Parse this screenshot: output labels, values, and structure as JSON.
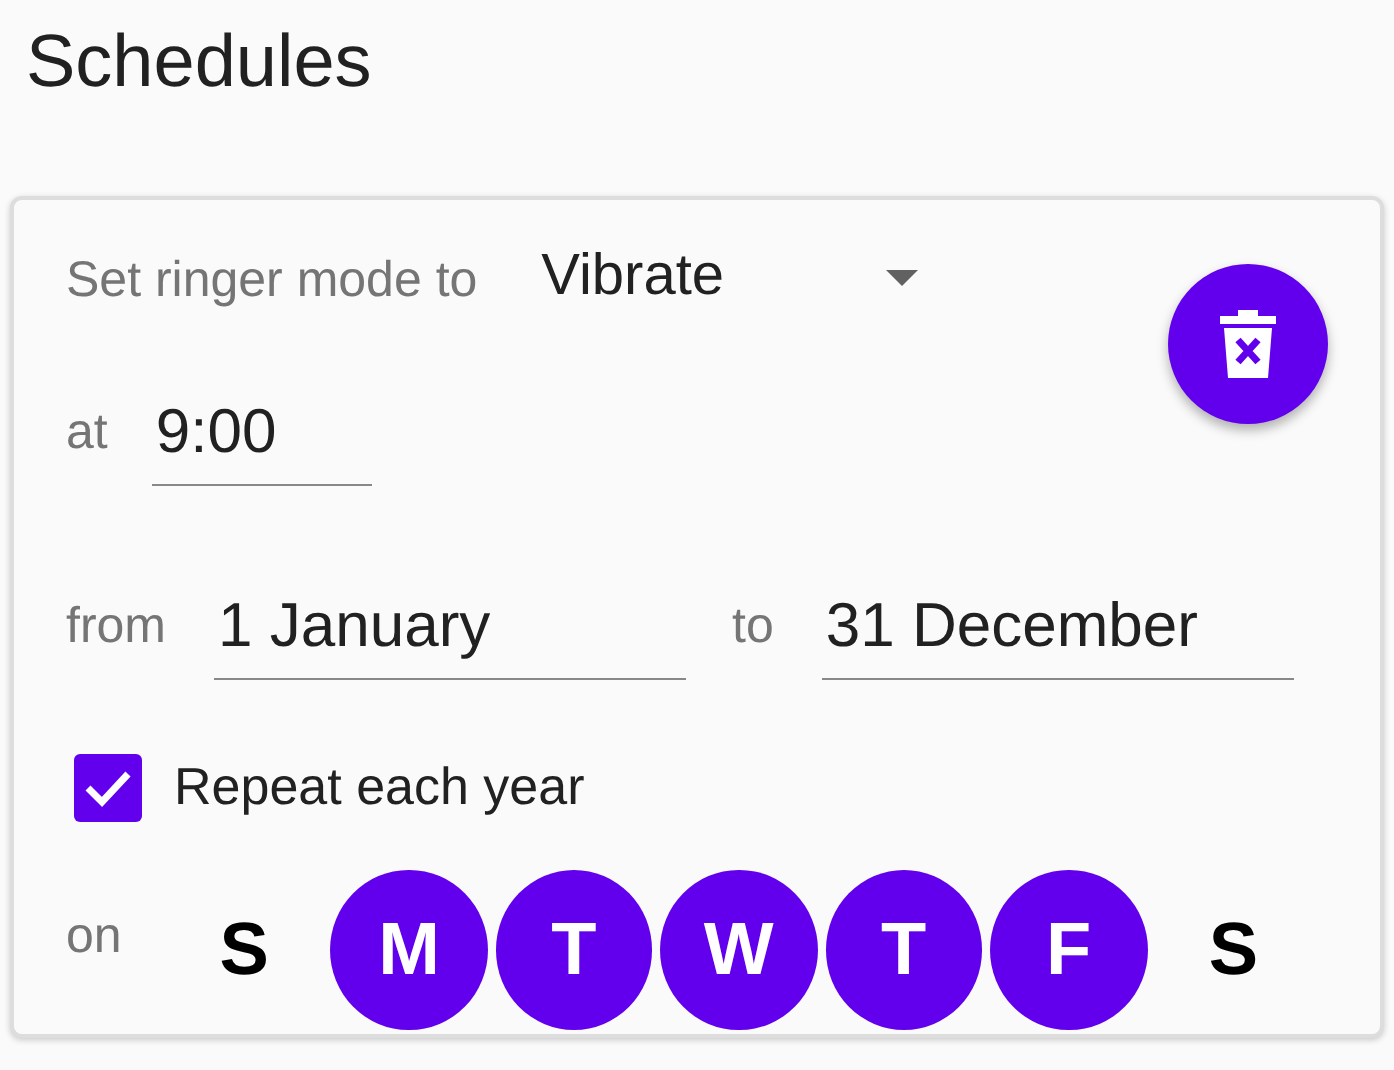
{
  "title": "Schedules",
  "schedule": {
    "mode_label": "Set ringer mode to",
    "mode": "Vibrate",
    "time_label": "at",
    "time": "9:00",
    "from_label": "from",
    "from": "1 January",
    "to_label": "to",
    "to": "31 December",
    "repeat": {
      "label": "Repeat each year",
      "checked": true
    },
    "days_label": "on",
    "days": [
      {
        "label": "S",
        "selected": false
      },
      {
        "label": "M",
        "selected": true
      },
      {
        "label": "T",
        "selected": true
      },
      {
        "label": "W",
        "selected": true
      },
      {
        "label": "T",
        "selected": true
      },
      {
        "label": "F",
        "selected": true
      },
      {
        "label": "S",
        "selected": false
      }
    ]
  }
}
